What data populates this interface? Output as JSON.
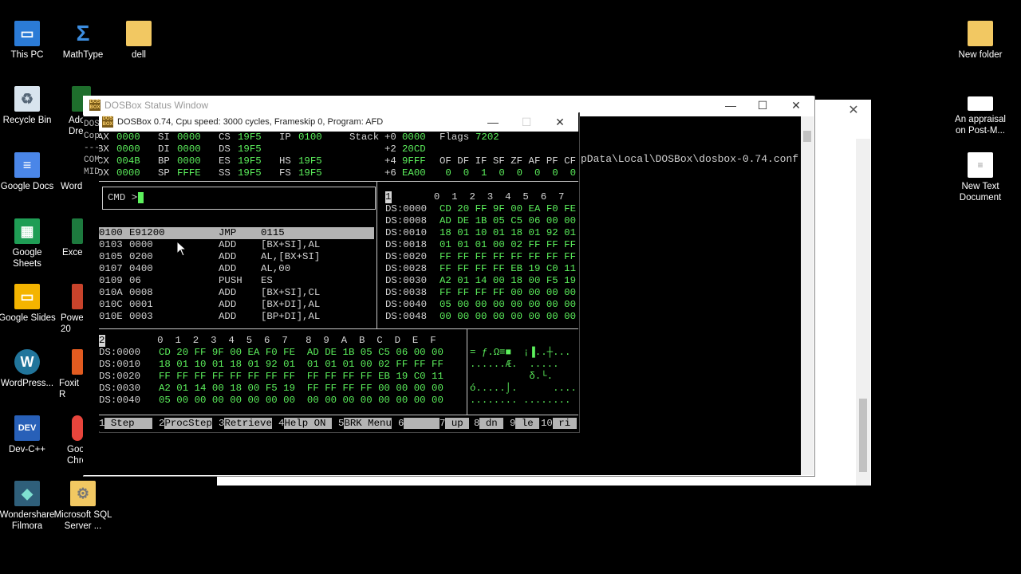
{
  "desktop": {
    "left_icons": [
      {
        "label": "This PC",
        "icon": "pc-icon"
      },
      {
        "label": "MathType",
        "icon": "sigma-icon"
      },
      {
        "label": "dell",
        "icon": "folder-icon"
      },
      {
        "label": "Recycle Bin",
        "icon": "recycle-bin-icon"
      },
      {
        "label": "Google Docs",
        "icon": "docs-icon"
      },
      {
        "label": "Google Sheets",
        "icon": "sheets-icon"
      },
      {
        "label": "Google Slides",
        "icon": "slides-icon"
      },
      {
        "label": "WordPress...",
        "icon": "wordpress-icon"
      },
      {
        "label": "Dev-C++",
        "icon": "devcpp-icon"
      },
      {
        "label": "Wondershare Filmora",
        "icon": "filmora-icon"
      },
      {
        "label": "Microsoft SQL Server ...",
        "icon": "sqlserver-icon"
      }
    ],
    "partial_icons": [
      {
        "label": "Ado Dream",
        "icon": "dreamweaver-icon"
      },
      {
        "label": "Word",
        "icon": "word-icon"
      },
      {
        "label": "Excel",
        "icon": "excel-icon"
      },
      {
        "label": "Powe 20",
        "icon": "powerpoint-icon"
      },
      {
        "label": "Foxit R",
        "icon": "foxit-icon"
      },
      {
        "label": "Goo Chro",
        "icon": "chrome-icon"
      }
    ],
    "right_icons": [
      {
        "label": "New folder",
        "icon": "folder-icon"
      },
      {
        "label": "An appraisal on Post-M...",
        "icon": "document-icon"
      },
      {
        "label": "New Text Document",
        "icon": "text-document-icon"
      }
    ]
  },
  "status_window": {
    "title": "DOSBox Status Window",
    "console_text": "pData\\Local\\DOSBox\\dosbox-0.74.conf",
    "left_text": "DOS\nCop\n---\nCOM\nMID"
  },
  "dosbox_window": {
    "title": "DOSBox 0.74, Cpu speed:    3000 cycles, Frameskip  0, Program:      AFD",
    "icon_text": "DOS BOX"
  },
  "debugger": {
    "registers": [
      [
        "AX",
        "0000",
        "SI",
        "0000",
        "CS",
        "19F5",
        "IP",
        "0100"
      ],
      [
        "BX",
        "0000",
        "DI",
        "0000",
        "DS",
        "19F5",
        "",
        ""
      ],
      [
        "CX",
        "004B",
        "BP",
        "0000",
        "ES",
        "19F5",
        "HS",
        "19F5"
      ],
      [
        "DX",
        "0000",
        "SP",
        "FFFE",
        "SS",
        "19F5",
        "FS",
        "19F5"
      ]
    ],
    "stack_label": "Stack",
    "stack": [
      "+0 0000",
      "+2 20CD",
      "+4 9FFF",
      "+6 EA00"
    ],
    "flags_label": "Flags",
    "flags_value": "7202",
    "flag_names": "OF DF IF SF ZF AF PF CF",
    "flag_values": " 0  0  1  0  0  0  0  0",
    "cmd_label": "CMD >",
    "disasm": [
      {
        "addr": "0100",
        "bytes": "E91200",
        "op": "JMP",
        "args": "0115"
      },
      {
        "addr": "0103",
        "bytes": "0000",
        "op": "ADD",
        "args": "[BX+SI],AL"
      },
      {
        "addr": "0105",
        "bytes": "0200",
        "op": "ADD",
        "args": "AL,[BX+SI]"
      },
      {
        "addr": "0107",
        "bytes": "0400",
        "op": "ADD",
        "args": "AL,00"
      },
      {
        "addr": "0109",
        "bytes": "06",
        "op": "PUSH",
        "args": "ES"
      },
      {
        "addr": "010A",
        "bytes": "0008",
        "op": "ADD",
        "args": "[BX+SI],CL"
      },
      {
        "addr": "010C",
        "bytes": "0001",
        "op": "ADD",
        "args": "[BX+DI],AL"
      },
      {
        "addr": "010E",
        "bytes": "0003",
        "op": "ADD",
        "args": "[BP+DI],AL"
      }
    ],
    "mem1_header_num": "1",
    "mem1_header": "  0  1  2  3  4  5  6  7",
    "mem1": [
      {
        "addr": "DS:0000",
        "bytes": "CD 20 FF 9F 00 EA F0 FE"
      },
      {
        "addr": "DS:0008",
        "bytes": "AD DE 1B 05 C5 06 00 00"
      },
      {
        "addr": "DS:0010",
        "bytes": "18 01 10 01 18 01 92 01"
      },
      {
        "addr": "DS:0018",
        "bytes": "01 01 01 00 02 FF FF FF"
      },
      {
        "addr": "DS:0020",
        "bytes": "FF FF FF FF FF FF FF FF"
      },
      {
        "addr": "DS:0028",
        "bytes": "FF FF FF FF EB 19 C0 11"
      },
      {
        "addr": "DS:0030",
        "bytes": "A2 01 14 00 18 00 F5 19"
      },
      {
        "addr": "DS:0038",
        "bytes": "FF FF FF FF 00 00 00 00"
      },
      {
        "addr": "DS:0040",
        "bytes": "05 00 00 00 00 00 00 00"
      },
      {
        "addr": "DS:0048",
        "bytes": "00 00 00 00 00 00 00 00"
      }
    ],
    "mem2_header_num": "2",
    "mem2_header": "     0  1  2  3  4  5  6  7   8  9  A  B  C  D  E  F",
    "mem2": [
      {
        "addr": "DS:0000",
        "bytes": "CD 20 FF 9F 00 EA F0 FE  AD DE 1B 05 C5 06 00 00",
        "ascii": "= ƒ.Ω≡■  ¡▐..┼..."
      },
      {
        "addr": "DS:0010",
        "bytes": "18 01 10 01 18 01 92 01  01 01 01 00 02 FF FF FF",
        "ascii": "......Æ.  ....."
      },
      {
        "addr": "DS:0020",
        "bytes": "FF FF FF FF FF FF FF FF  FF FF FF FF EB 19 C0 11",
        "ascii": "          δ.└."
      },
      {
        "addr": "DS:0030",
        "bytes": "A2 01 14 00 18 00 F5 19  FF FF FF FF 00 00 00 00",
        "ascii": "ó.....⌡.      ...."
      },
      {
        "addr": "DS:0040",
        "bytes": "05 00 00 00 00 00 00 00  00 00 00 00 00 00 00 00",
        "ascii": "........ ........"
      }
    ],
    "function_keys": [
      {
        "num": "1",
        "label": " Step   "
      },
      {
        "num": "2",
        "label": "ProcStep"
      },
      {
        "num": "3",
        "label": "Retrieve"
      },
      {
        "num": "4",
        "label": "Help ON "
      },
      {
        "num": "5",
        "label": "BRK Menu"
      },
      {
        "num": "6",
        "label": "      "
      },
      {
        "num": "7",
        "label": " up "
      },
      {
        "num": "8",
        "label": " dn "
      },
      {
        "num": "9",
        "label": " le "
      },
      {
        "num": "10",
        "label": " ri "
      }
    ]
  },
  "colors": {
    "dos_green": "#5cf05c",
    "dos_gray": "#b4b4b4"
  }
}
